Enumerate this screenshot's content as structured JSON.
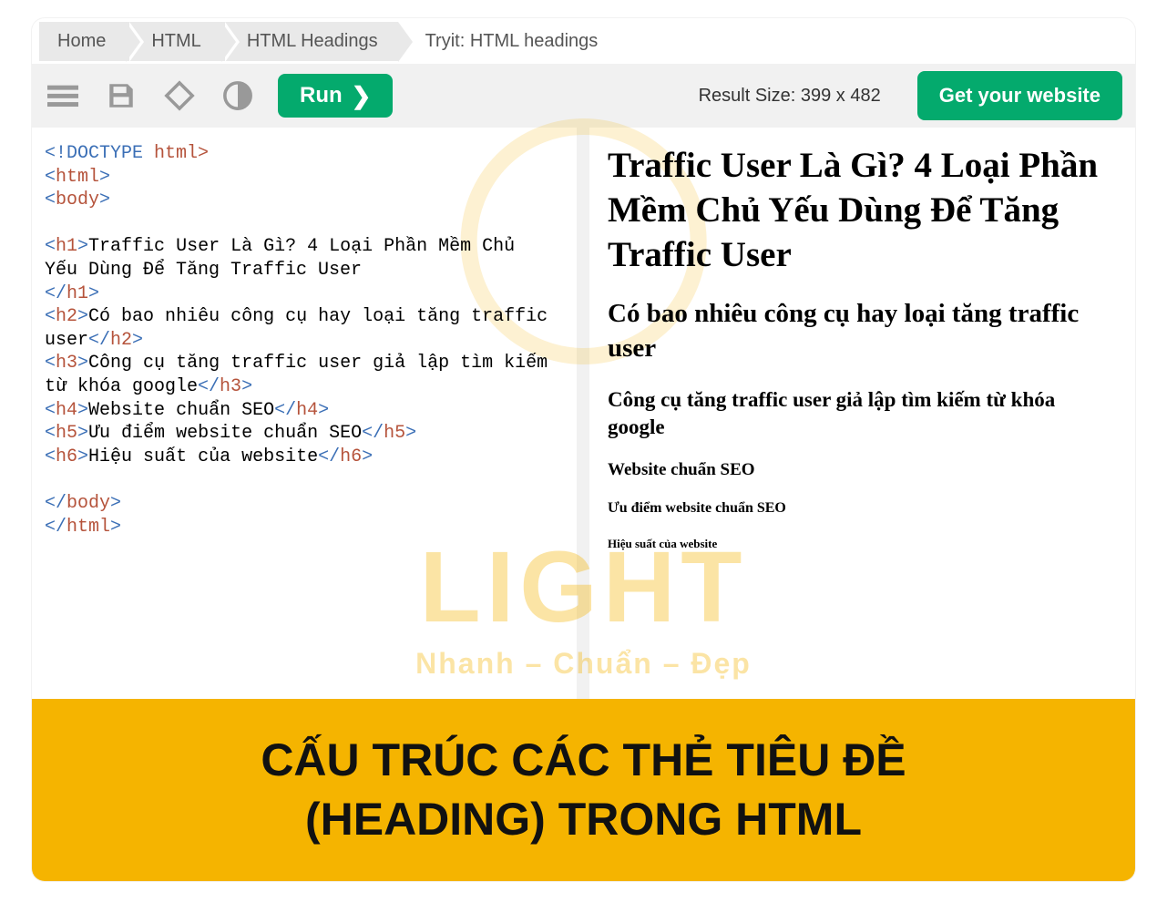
{
  "breadcrumbs": {
    "items": [
      "Home",
      "HTML",
      "HTML Headings"
    ],
    "current": "Tryit: HTML headings"
  },
  "toolbar": {
    "run_label": "Run",
    "result_size_label": "Result Size: 399 x 482",
    "cta_label": "Get your website"
  },
  "code": {
    "doctype_kw": "<!DOCTYPE",
    "doctype_rest": " html>",
    "html_open_l": "<",
    "html_open_n": "html",
    "html_open_r": ">",
    "body_open_l": "<",
    "body_open_n": "body",
    "body_open_r": ">",
    "h1_open_l": "<",
    "h1_open_n": "h1",
    "h1_open_r": ">",
    "h1_text_a": "Traffic User Là Gì? 4 Loại Phần Mềm Chủ ",
    "h1_text_b": "Yếu Dùng Để Tăng Traffic User",
    "h1_close_l": "</",
    "h1_close_n": "h1",
    "h1_close_r": ">",
    "h2_open_l": "<",
    "h2_open_n": "h2",
    "h2_open_r": ">",
    "h2_text_a": "Có bao nhiêu công cụ hay loại tăng traffic ",
    "h2_text_b": "user",
    "h2_close_l": "</",
    "h2_close_n": "h2",
    "h2_close_r": ">",
    "h3_open_l": "<",
    "h3_open_n": "h3",
    "h3_open_r": ">",
    "h3_text_a": "Công cụ tăng traffic user giả lập tìm kiếm ",
    "h3_text_b": "từ khóa google",
    "h3_close_l": "</",
    "h3_close_n": "h3",
    "h3_close_r": ">",
    "h4_open_l": "<",
    "h4_open_n": "h4",
    "h4_open_r": ">",
    "h4_text": "Website chuẩn SEO",
    "h4_close_l": "</",
    "h4_close_n": "h4",
    "h4_close_r": ">",
    "h5_open_l": "<",
    "h5_open_n": "h5",
    "h5_open_r": ">",
    "h5_text": "Ưu điểm website chuẩn SEO",
    "h5_close_l": "</",
    "h5_close_n": "h5",
    "h5_close_r": ">",
    "h6_open_l": "<",
    "h6_open_n": "h6",
    "h6_open_r": ">",
    "h6_text": "Hiệu suất của website",
    "h6_close_l": "</",
    "h6_close_n": "h6",
    "h6_close_r": ">",
    "body_close_l": "</",
    "body_close_n": "body",
    "body_close_r": ">",
    "html_close_l": "</",
    "html_close_n": "html",
    "html_close_r": ">"
  },
  "result": {
    "h1": "Traffic User Là Gì? 4 Loại Phần Mềm Chủ Yếu Dùng Để Tăng Traffic User",
    "h2": "Có bao nhiêu công cụ hay loại tăng traffic user",
    "h3": "Công cụ tăng traffic user giả lập tìm kiếm từ khóa google",
    "h4": "Website chuẩn SEO",
    "h5": "Ưu điểm website chuẩn SEO",
    "h6": "Hiệu suất của website"
  },
  "watermark": {
    "brand": "LIGHT",
    "tagline": "Nhanh – Chuẩn – Đẹp"
  },
  "banner": {
    "line1": "CẤU TRÚC CÁC THẺ TIÊU ĐỀ",
    "line2": "(HEADING) TRONG HTML"
  }
}
